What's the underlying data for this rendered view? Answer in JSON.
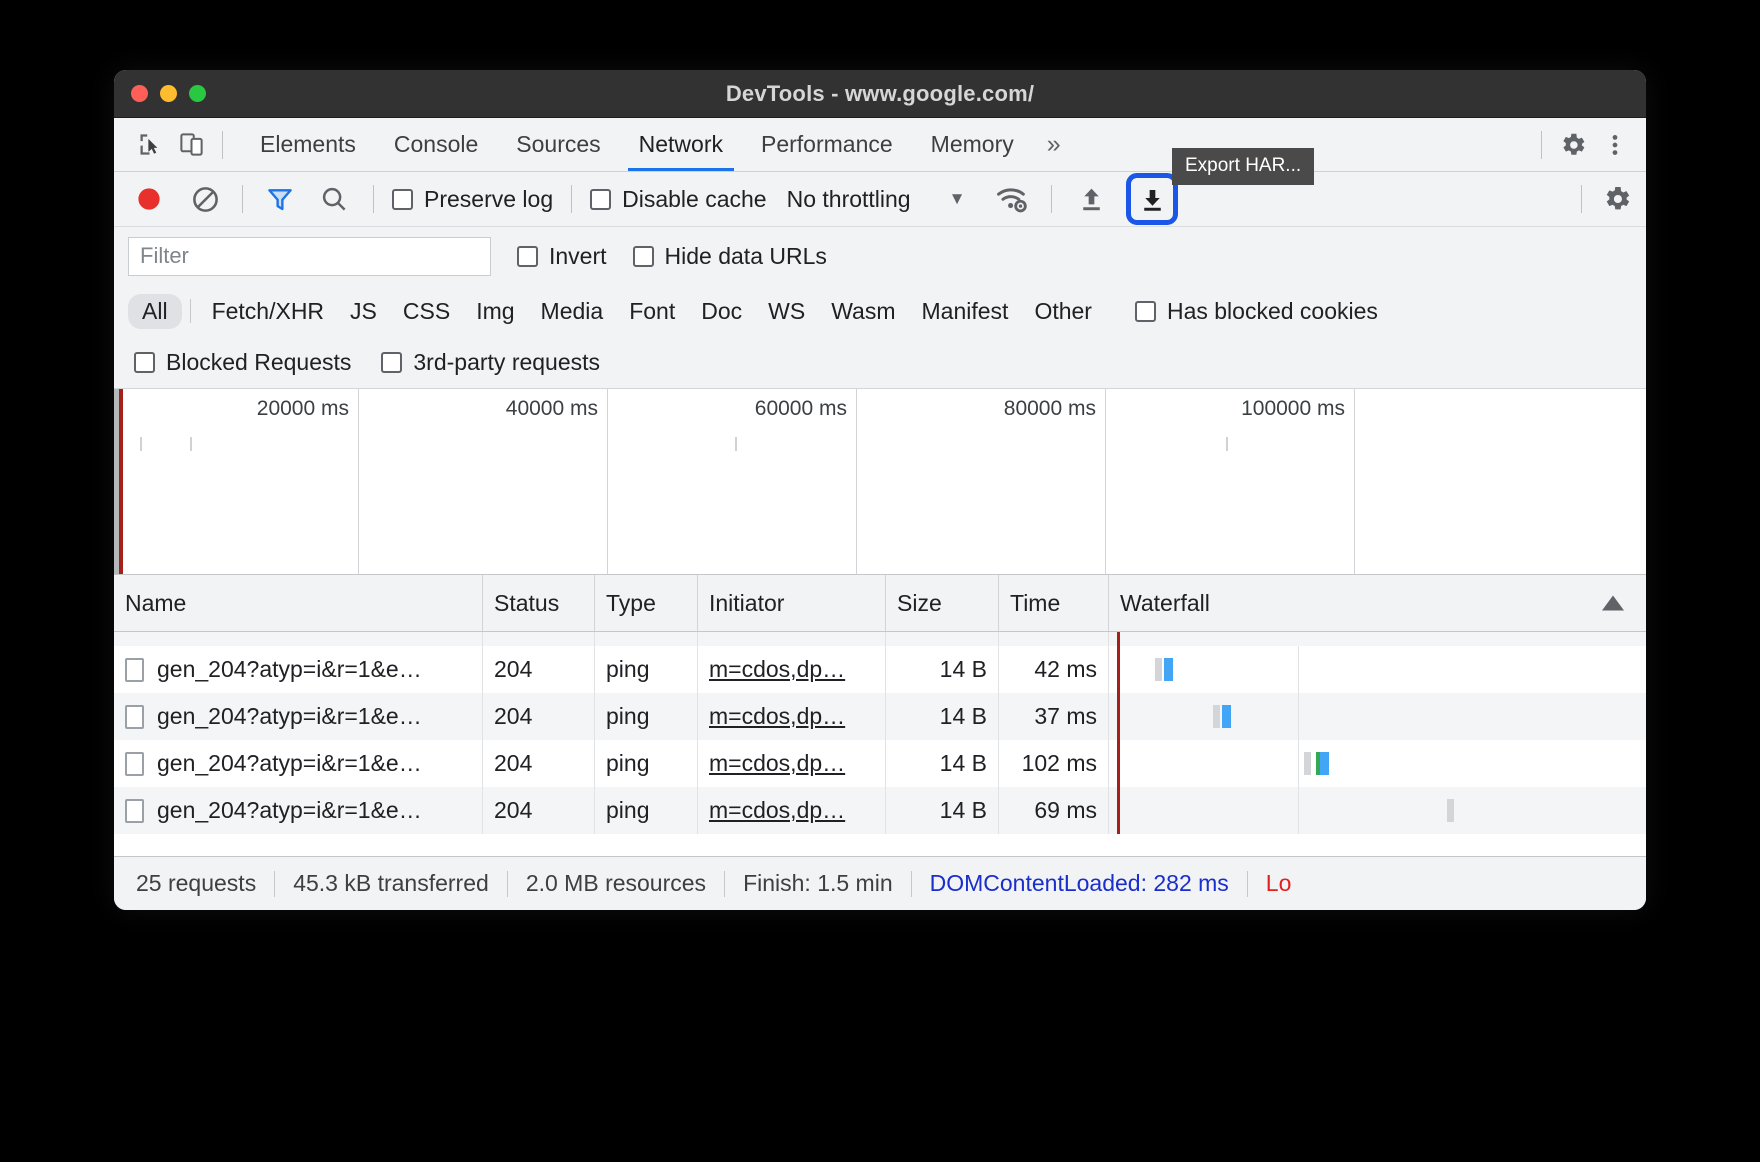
{
  "window": {
    "title": "DevTools - www.google.com/",
    "traffic_lights": [
      "close-red",
      "minimize-yellow",
      "maximize-green"
    ]
  },
  "panel_bar": {
    "icons": [
      "inspect-element-icon",
      "device-toolbar-icon"
    ],
    "tabs": [
      {
        "label": "Elements",
        "active": false
      },
      {
        "label": "Console",
        "active": false
      },
      {
        "label": "Sources",
        "active": false
      },
      {
        "label": "Network",
        "active": true
      },
      {
        "label": "Performance",
        "active": false
      },
      {
        "label": "Memory",
        "active": false
      }
    ],
    "more_tabs": "»",
    "settings_icon": "gear-icon",
    "menu_icon": "kebab-menu-icon"
  },
  "network_toolbar": {
    "record_icon": "record-icon",
    "clear_icon": "clear-icon",
    "filter_icon": "filter-icon",
    "search_icon": "search-icon",
    "preserve_log": {
      "label": "Preserve log",
      "checked": false
    },
    "disable_cache": {
      "label": "Disable cache",
      "checked": false
    },
    "throttling": {
      "value": "No throttling",
      "caret": "▼"
    },
    "network_conditions_icon": "wifi-settings-icon",
    "import_har_icon": "upload-arrow-icon",
    "export_har_icon": "download-arrow-icon",
    "export_har_focused": true,
    "settings_icon": "gear-icon",
    "tooltip": "Export HAR..."
  },
  "filter_row": {
    "filter_placeholder": "Filter",
    "filter_value": "",
    "invert": {
      "label": "Invert",
      "checked": false
    },
    "hide_data_urls": {
      "label": "Hide data URLs",
      "checked": false
    }
  },
  "type_filters": {
    "all": "All",
    "types": [
      "Fetch/XHR",
      "JS",
      "CSS",
      "Img",
      "Media",
      "Font",
      "Doc",
      "WS",
      "Wasm",
      "Manifest",
      "Other"
    ],
    "has_blocked_cookies": {
      "label": "Has blocked cookies",
      "checked": false
    },
    "blocked_requests": {
      "label": "Blocked Requests",
      "checked": false
    },
    "third_party_requests": {
      "label": "3rd-party requests",
      "checked": false
    }
  },
  "chart_data": {
    "type": "timeline",
    "title": "Network overview timeline",
    "xlabel": "",
    "ylabel": "",
    "tick_labels": [
      "20000 ms",
      "40000 ms",
      "60000 ms",
      "80000 ms",
      "100000 ms"
    ],
    "tick_values": [
      20000,
      40000,
      60000,
      80000,
      100000
    ],
    "xlim": [
      0,
      120000
    ],
    "grid": true,
    "markers": [
      {
        "name": "DOMContentLoaded",
        "color": "#1a2ecc",
        "value": 282
      },
      {
        "name": "Load",
        "color": "#a52019",
        "value": 290
      }
    ]
  },
  "table": {
    "columns": [
      "Name",
      "Status",
      "Type",
      "Initiator",
      "Size",
      "Time",
      "Waterfall"
    ],
    "sort_column": "Waterfall",
    "sort_direction": "ascending",
    "rows": [
      {
        "name": "gen_204?atyp=i&r=1&e…",
        "status": "204",
        "type": "ping",
        "initiator": "m=cdos,dp…",
        "size": "14 B",
        "time": "42 ms"
      },
      {
        "name": "gen_204?atyp=i&r=1&e…",
        "status": "204",
        "type": "ping",
        "initiator": "m=cdos,dp…",
        "size": "14 B",
        "time": "37 ms"
      },
      {
        "name": "gen_204?atyp=i&r=1&e…",
        "status": "204",
        "type": "ping",
        "initiator": "m=cdos,dp…",
        "size": "14 B",
        "time": "102 ms"
      },
      {
        "name": "gen_204?atyp=i&r=1&e…",
        "status": "204",
        "type": "ping",
        "initiator": "m=cdos,dp…",
        "size": "14 B",
        "time": "69 ms"
      }
    ]
  },
  "status_bar": {
    "requests": "25 requests",
    "transferred": "45.3 kB transferred",
    "resources": "2.0 MB resources",
    "finish": "Finish: 1.5 min",
    "dom_content_loaded": "DOMContentLoaded: 282 ms",
    "load": "Lo"
  },
  "colors": {
    "accent_blue": "#1a73e8",
    "focus_ring": "#1a56e8",
    "record_red": "#e8302c",
    "load_red": "#a52019",
    "dcl_blue": "#1a2ecc",
    "waterfall_download": "#42a5f5",
    "waterfall_queue": "#d3d5d8",
    "waterfall_green": "#34a853"
  }
}
